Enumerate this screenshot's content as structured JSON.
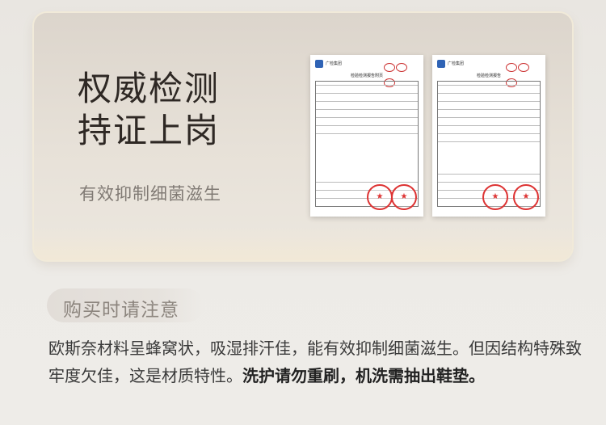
{
  "card": {
    "title": "权威检测\n持证上岗",
    "subtitle": "有效抑制细菌滋生"
  },
  "reports": [
    {
      "org": "广检集团",
      "title": "检验检测报告附页"
    },
    {
      "org": "广检集团",
      "title": "检验检测报告"
    }
  ],
  "notice": {
    "label": "购买时请注意",
    "text_normal": "欧斯奈材料呈蜂窝状，吸湿排汗佳，能有效抑制细菌滋生。但因结构特殊致牢度欠佳，这是材质特性。",
    "text_bold": "洗护请勿重刷，机洗需抽出鞋垫。"
  },
  "colors": {
    "seal": "#dd3333",
    "logo": "#2f63b5"
  }
}
